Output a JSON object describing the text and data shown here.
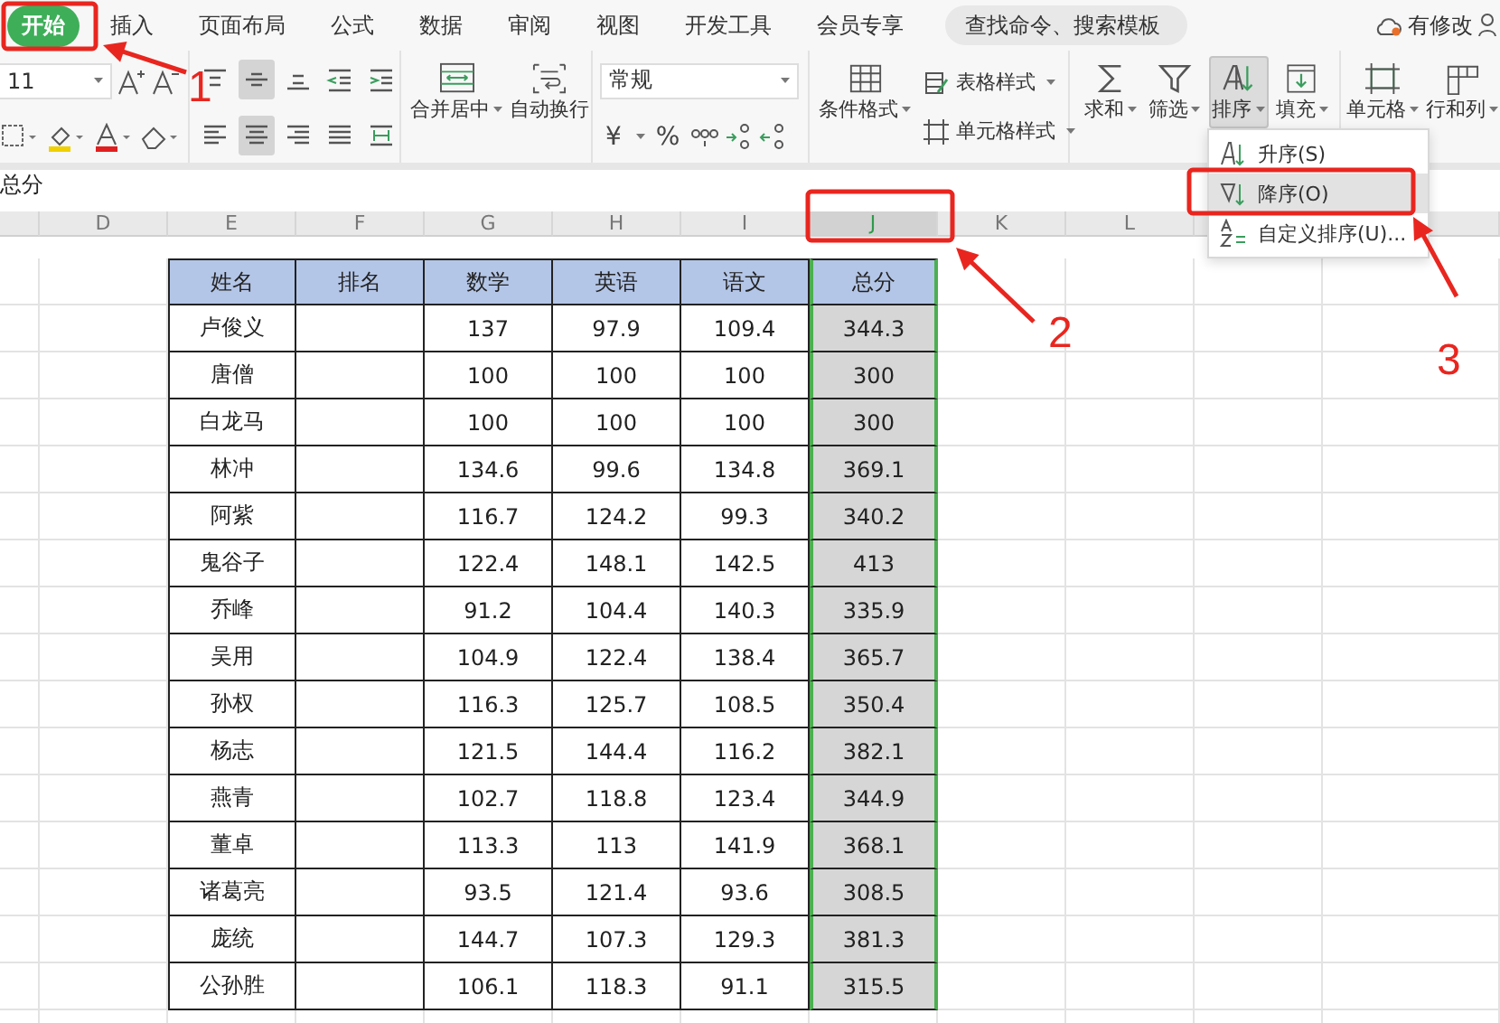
{
  "tabs": [
    {
      "label": "开始",
      "selected": true
    },
    {
      "label": "插入",
      "selected": false
    },
    {
      "label": "页面布局",
      "selected": false
    },
    {
      "label": "公式",
      "selected": false
    },
    {
      "label": "数据",
      "selected": false
    },
    {
      "label": "审阅",
      "selected": false
    },
    {
      "label": "视图",
      "selected": false
    },
    {
      "label": "开发工具",
      "selected": false
    },
    {
      "label": "会员专享",
      "selected": false
    }
  ],
  "search": {
    "placeholder": "查找命令、搜索模板"
  },
  "save_status": "有修改",
  "ribbon": {
    "font_size": "11",
    "align_buttons": [
      {
        "kind": "top",
        "selected": false
      },
      {
        "kind": "middle",
        "selected": true
      },
      {
        "kind": "bottom",
        "selected": false
      },
      {
        "kind": "outdent",
        "selected": false
      },
      {
        "kind": "indent",
        "selected": false
      },
      {
        "kind": "left",
        "selected": false
      },
      {
        "kind": "center",
        "selected": true
      },
      {
        "kind": "right",
        "selected": false
      },
      {
        "kind": "justify",
        "selected": false
      },
      {
        "kind": "distributed",
        "selected": false
      }
    ],
    "merge_button": "合并居中",
    "wrap_button": "自动换行",
    "number_format": "常规",
    "number_symbols": [
      "¥",
      "%"
    ],
    "conditional_format": "条件格式",
    "style_buttons": [
      "表格样式",
      "单元格样式"
    ],
    "tools": [
      {
        "label": "求和",
        "kind": "sum",
        "selected": false
      },
      {
        "label": "筛选",
        "kind": "filter",
        "selected": false
      },
      {
        "label": "排序",
        "kind": "sort",
        "selected": true
      },
      {
        "label": "填充",
        "kind": "fill",
        "selected": false
      }
    ],
    "cell_buttons": [
      "单元格",
      "行和列"
    ]
  },
  "formula_bar": {
    "value": "总分"
  },
  "columns": [
    {
      "label": "D",
      "selected": false
    },
    {
      "label": "E",
      "selected": false
    },
    {
      "label": "F",
      "selected": false
    },
    {
      "label": "G",
      "selected": false
    },
    {
      "label": "H",
      "selected": false
    },
    {
      "label": "I",
      "selected": false
    },
    {
      "label": "J",
      "selected": true
    },
    {
      "label": "K",
      "selected": false
    },
    {
      "label": "L",
      "selected": false
    }
  ],
  "table": {
    "columns": [
      "姓名",
      "排名",
      "数学",
      "英语",
      "语文",
      "总分"
    ],
    "rows": [
      [
        "卢俊义",
        "",
        "137",
        "97.9",
        "109.4",
        "344.3"
      ],
      [
        "唐僧",
        "",
        "100",
        "100",
        "100",
        "300"
      ],
      [
        "白龙马",
        "",
        "100",
        "100",
        "100",
        "300"
      ],
      [
        "林冲",
        "",
        "134.6",
        "99.6",
        "134.8",
        "369.1"
      ],
      [
        "阿紫",
        "",
        "116.7",
        "124.2",
        "99.3",
        "340.2"
      ],
      [
        "鬼谷子",
        "",
        "122.4",
        "148.1",
        "142.5",
        "413"
      ],
      [
        "乔峰",
        "",
        "91.2",
        "104.4",
        "140.3",
        "335.9"
      ],
      [
        "吴用",
        "",
        "104.9",
        "122.4",
        "138.4",
        "365.7"
      ],
      [
        "孙权",
        "",
        "116.3",
        "125.7",
        "108.5",
        "350.4"
      ],
      [
        "杨志",
        "",
        "121.5",
        "144.4",
        "116.2",
        "382.1"
      ],
      [
        "燕青",
        "",
        "102.7",
        "118.8",
        "123.4",
        "344.9"
      ],
      [
        "董卓",
        "",
        "113.3",
        "113",
        "141.9",
        "368.1"
      ],
      [
        "诸葛亮",
        "",
        "93.5",
        "121.4",
        "93.6",
        "308.5"
      ],
      [
        "庞统",
        "",
        "144.7",
        "107.3",
        "129.3",
        "381.3"
      ],
      [
        "公孙胜",
        "",
        "106.1",
        "118.3",
        "91.1",
        "315.5"
      ]
    ]
  },
  "sort_menu": [
    {
      "label": "升序(S)",
      "kind": "ascending",
      "selected": false
    },
    {
      "label": "降序(O)",
      "kind": "descending",
      "selected": true
    },
    {
      "label": "自定义排序(U)...",
      "kind": "custom",
      "selected": false
    }
  ],
  "annotations": [
    "1",
    "2",
    "3"
  ]
}
